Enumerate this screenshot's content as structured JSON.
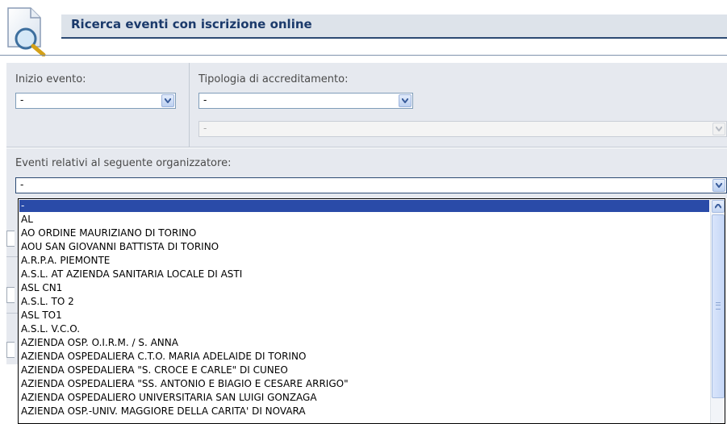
{
  "header": {
    "icon": "search-document-icon",
    "title": "Ricerca eventi con iscrizione online"
  },
  "filters": {
    "inizio_evento": {
      "label": "Inizio evento:",
      "value": "-"
    },
    "tipologia": {
      "label": "Tipologia di accreditamento:",
      "value": "-",
      "sub_value": "-"
    },
    "organizzatore": {
      "label": "Eventi relativi al seguente organizzatore:",
      "value": "-"
    }
  },
  "dropdown": {
    "selected_index": 0,
    "options": [
      "-",
      "AL",
      "AO ORDINE MAURIZIANO DI TORINO",
      "AOU SAN GIOVANNI BATTISTA DI TORINO",
      "A.R.P.A. PIEMONTE",
      "A.S.L. AT AZIENDA SANITARIA LOCALE DI ASTI",
      "ASL CN1",
      "A.S.L. TO 2",
      "ASL TO1",
      "A.S.L. V.C.O.",
      "AZIENDA OSP. O.I.R.M. / S. ANNA",
      "AZIENDA OSPEDALIERA C.T.O. MARIA ADELAIDE DI TORINO",
      "AZIENDA OSPEDALIERA \"S. CROCE E CARLE\" DI CUNEO",
      "AZIENDA OSPEDALIERA \"SS. ANTONIO E BIAGIO E CESARE ARRIGO\"",
      "AZIENDA OSPEDALIERO UNIVERSITARIA SAN LUIGI GONZAGA",
      "AZIENDA OSP.-UNIV. MAGGIORE DELLA CARITA' DI NOVARA"
    ]
  }
}
